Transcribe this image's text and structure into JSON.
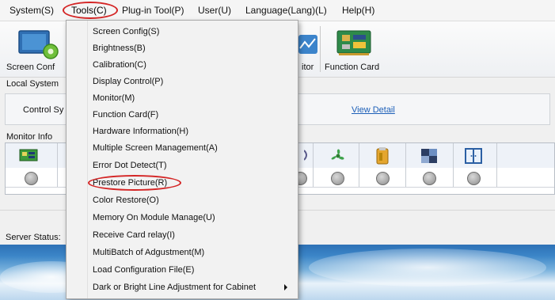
{
  "menubar": {
    "items": [
      "System(S)",
      "Tools(C)",
      "Plug-in Tool(P)",
      "User(U)",
      "Language(Lang)(L)",
      "Help(H)"
    ],
    "active": "Tools(C)"
  },
  "toolbar": {
    "screen_config_label": "Screen Conf",
    "monitor_label": "itor",
    "function_card_label": "Function Card"
  },
  "main": {
    "local_system_label": "Local System",
    "control_system_label": "Control Sy",
    "view_detail_link": "View Detail",
    "monitor_info_label": "Monitor Info",
    "server_status_label": "Server Status:"
  },
  "tools_menu": {
    "items": [
      "Screen Config(S)",
      "Brightness(B)",
      "Calibration(C)",
      "Display Control(P)",
      "Monitor(M)",
      "Function Card(F)",
      "Hardware Information(H)",
      "Multiple Screen Management(A)",
      "Error Dot Detect(T)",
      "Prestore Picture(R)",
      "Color Restore(O)",
      "Memory On Module Manage(U)",
      "Receive Card relay(I)",
      "MultiBatch of Adgustment(M)",
      "Load Configuration File(E)",
      "Dark or Bright Line Adjustment for Cabinet"
    ],
    "highlighted": "Prestore Picture(R)",
    "submenu_item": "Dark or Bright Line Adjustment for Cabinet"
  },
  "icons": {
    "monitor_row": [
      "card-chip-icon",
      "fan-icon",
      "power-supply-icon",
      "module-icon",
      "cabinet-door-icon"
    ],
    "status": [
      "status-grey-dot",
      "status-grey-dot",
      "status-grey-dot",
      "status-grey-dot",
      "status-grey-dot",
      "status-grey-dot",
      "status-grey-dot"
    ]
  },
  "colors": {
    "annotation_red": "#d42525",
    "link_blue": "#1c5fb8"
  }
}
